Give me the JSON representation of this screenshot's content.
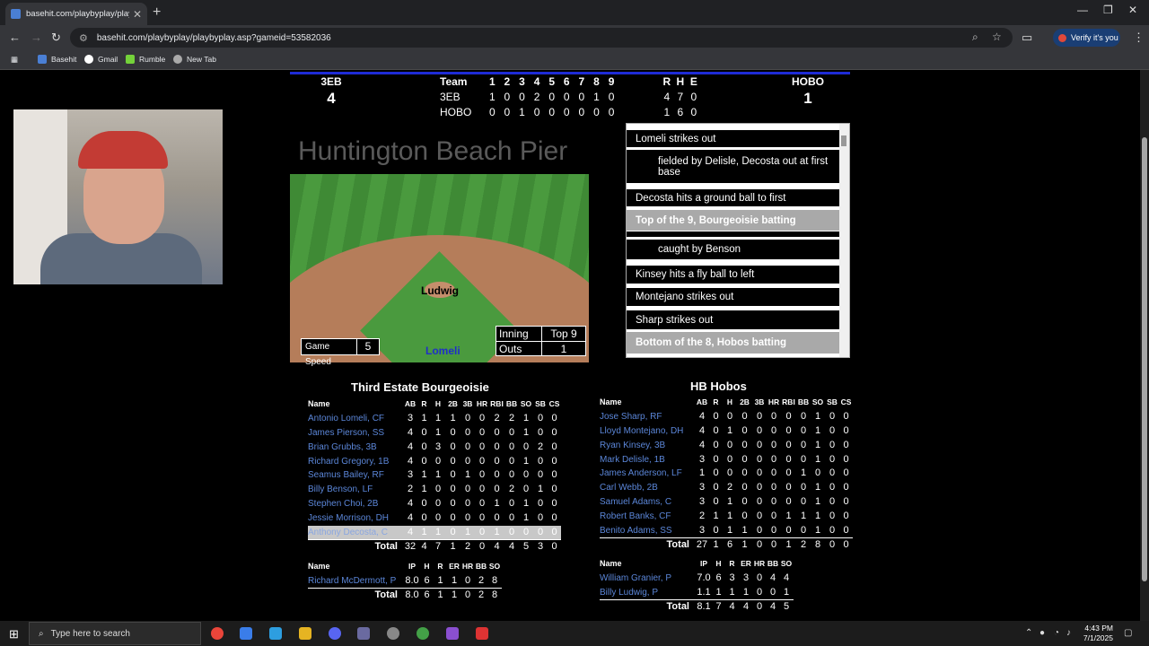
{
  "browser": {
    "tab_title": "basehit.com/playbyplay/playby",
    "url": "basehit.com/playbyplay/playbyplay.asp?gameid=53582036",
    "verify_label": "Verify it's you",
    "bookmarks": [
      "Basehit",
      "Gmail",
      "Rumble",
      "New Tab"
    ]
  },
  "scoreboard": {
    "away_abbr": "3EB",
    "away_runs": "4",
    "home_abbr": "HOBO",
    "home_runs": "1",
    "header": {
      "team": "Team",
      "innings": [
        "1",
        "2",
        "3",
        "4",
        "5",
        "6",
        "7",
        "8",
        "9"
      ],
      "rhe": [
        "R",
        "H",
        "E"
      ]
    },
    "rows": [
      {
        "team": "3EB",
        "innings": [
          "1",
          "0",
          "0",
          "2",
          "0",
          "0",
          "0",
          "1",
          "0"
        ],
        "rhe": [
          "4",
          "7",
          "0"
        ]
      },
      {
        "team": "HOBO",
        "innings": [
          "0",
          "0",
          "1",
          "0",
          "0",
          "0",
          "0",
          "0",
          "0"
        ],
        "rhe": [
          "1",
          "6",
          "0"
        ]
      }
    ]
  },
  "game": {
    "stadium": "Huntington Beach Pier",
    "pitcher_on_mound": "Ludwig",
    "batter": "Lomeli",
    "speed_label": "Game Speed",
    "speed_value": "5",
    "inning_label": "Inning",
    "inning_value": "Top 9",
    "outs_label": "Outs",
    "outs_value": "1"
  },
  "log": [
    "Lomeli strikes out",
    "fielded by Delisle, Decosta out at first base",
    "Decosta hits a ground ball to first",
    "Top of the 9, Bourgeoisie batting",
    "caught by Benson",
    "Kinsey hits a fly ball to left",
    "Montejano strikes out",
    "Sharp strikes out",
    "Bottom of the 8, Hobos batting"
  ],
  "away_box": {
    "team_name": "Third Estate Bourgeoisie",
    "name_header": "Name",
    "headers": [
      "AB",
      "R",
      "H",
      "2B",
      "3B",
      "HR",
      "RBI",
      "BB",
      "SO",
      "SB",
      "CS"
    ],
    "players": [
      {
        "name": "Antonio Lomeli, CF",
        "stats": [
          "3",
          "1",
          "1",
          "1",
          "0",
          "0",
          "2",
          "2",
          "1",
          "0",
          "0"
        ]
      },
      {
        "name": "James Pierson, SS",
        "stats": [
          "4",
          "0",
          "1",
          "0",
          "0",
          "0",
          "0",
          "0",
          "1",
          "0",
          "0"
        ]
      },
      {
        "name": "Brian Grubbs, 3B",
        "stats": [
          "4",
          "0",
          "3",
          "0",
          "0",
          "0",
          "0",
          "0",
          "0",
          "2",
          "0"
        ]
      },
      {
        "name": "Richard Gregory, 1B",
        "stats": [
          "4",
          "0",
          "0",
          "0",
          "0",
          "0",
          "0",
          "0",
          "1",
          "0",
          "0"
        ]
      },
      {
        "name": "Seamus Bailey, RF",
        "stats": [
          "3",
          "1",
          "1",
          "0",
          "1",
          "0",
          "0",
          "0",
          "0",
          "0",
          "0"
        ]
      },
      {
        "name": "Billy Benson, LF",
        "stats": [
          "2",
          "1",
          "0",
          "0",
          "0",
          "0",
          "0",
          "2",
          "0",
          "1",
          "0"
        ]
      },
      {
        "name": "Stephen Choi, 2B",
        "stats": [
          "4",
          "0",
          "0",
          "0",
          "0",
          "0",
          "1",
          "0",
          "1",
          "0",
          "0"
        ]
      },
      {
        "name": "Jessie Morrison, DH",
        "stats": [
          "4",
          "0",
          "0",
          "0",
          "0",
          "0",
          "0",
          "0",
          "1",
          "0",
          "0"
        ]
      },
      {
        "name": "Anthony Decosta, C",
        "stats": [
          "4",
          "1",
          "1",
          "0",
          "1",
          "0",
          "1",
          "0",
          "0",
          "0",
          "0"
        ]
      }
    ],
    "total_label": "Total",
    "totals": [
      "32",
      "4",
      "7",
      "1",
      "2",
      "0",
      "4",
      "4",
      "5",
      "3",
      "0"
    ],
    "pitch_headers": [
      "IP",
      "H",
      "R",
      "ER",
      "HR",
      "BB",
      "SO"
    ],
    "pitchers": [
      {
        "name": "Richard McDermott, P",
        "stats": [
          "8.0",
          "6",
          "1",
          "1",
          "0",
          "2",
          "8"
        ]
      }
    ],
    "pitch_totals": [
      "8.0",
      "6",
      "1",
      "1",
      "0",
      "2",
      "8"
    ]
  },
  "home_box": {
    "team_name": "HB Hobos",
    "name_header": "Name",
    "headers": [
      "AB",
      "R",
      "H",
      "2B",
      "3B",
      "HR",
      "RBI",
      "BB",
      "SO",
      "SB",
      "CS"
    ],
    "players": [
      {
        "name": "Jose Sharp, RF",
        "stats": [
          "4",
          "0",
          "0",
          "0",
          "0",
          "0",
          "0",
          "0",
          "1",
          "0",
          "0"
        ]
      },
      {
        "name": "Lloyd Montejano, DH",
        "stats": [
          "4",
          "0",
          "1",
          "0",
          "0",
          "0",
          "0",
          "0",
          "1",
          "0",
          "0"
        ]
      },
      {
        "name": "Ryan Kinsey, 3B",
        "stats": [
          "4",
          "0",
          "0",
          "0",
          "0",
          "0",
          "0",
          "0",
          "1",
          "0",
          "0"
        ]
      },
      {
        "name": "Mark Delisle, 1B",
        "stats": [
          "3",
          "0",
          "0",
          "0",
          "0",
          "0",
          "0",
          "0",
          "1",
          "0",
          "0"
        ]
      },
      {
        "name": "James Anderson, LF",
        "stats": [
          "1",
          "0",
          "0",
          "0",
          "0",
          "0",
          "0",
          "1",
          "0",
          "0",
          "0"
        ]
      },
      {
        "name": "Carl Webb, 2B",
        "stats": [
          "3",
          "0",
          "2",
          "0",
          "0",
          "0",
          "0",
          "0",
          "1",
          "0",
          "0"
        ]
      },
      {
        "name": "Samuel Adams, C",
        "stats": [
          "3",
          "0",
          "1",
          "0",
          "0",
          "0",
          "0",
          "0",
          "1",
          "0",
          "0"
        ]
      },
      {
        "name": "Robert Banks, CF",
        "stats": [
          "2",
          "1",
          "1",
          "0",
          "0",
          "0",
          "1",
          "1",
          "1",
          "0",
          "0"
        ]
      },
      {
        "name": "Benito Adams, SS",
        "stats": [
          "3",
          "0",
          "1",
          "1",
          "0",
          "0",
          "0",
          "0",
          "1",
          "0",
          "0"
        ]
      }
    ],
    "total_label": "Total",
    "totals": [
      "27",
      "1",
      "6",
      "1",
      "0",
      "0",
      "1",
      "2",
      "8",
      "0",
      "0"
    ],
    "pitch_headers": [
      "IP",
      "H",
      "R",
      "ER",
      "HR",
      "BB",
      "SO"
    ],
    "pitchers": [
      {
        "name": "William Granier, P",
        "stats": [
          "7.0",
          "6",
          "3",
          "3",
          "0",
          "4",
          "4"
        ]
      },
      {
        "name": "Billy Ludwig, P",
        "stats": [
          "1.1",
          "1",
          "1",
          "1",
          "0",
          "0",
          "1"
        ]
      }
    ],
    "pitch_totals": [
      "8.1",
      "7",
      "4",
      "4",
      "0",
      "4",
      "5"
    ]
  },
  "taskbar": {
    "search_placeholder": "Type here to search",
    "time": "4:43 PM",
    "date": "7/1/2025"
  }
}
